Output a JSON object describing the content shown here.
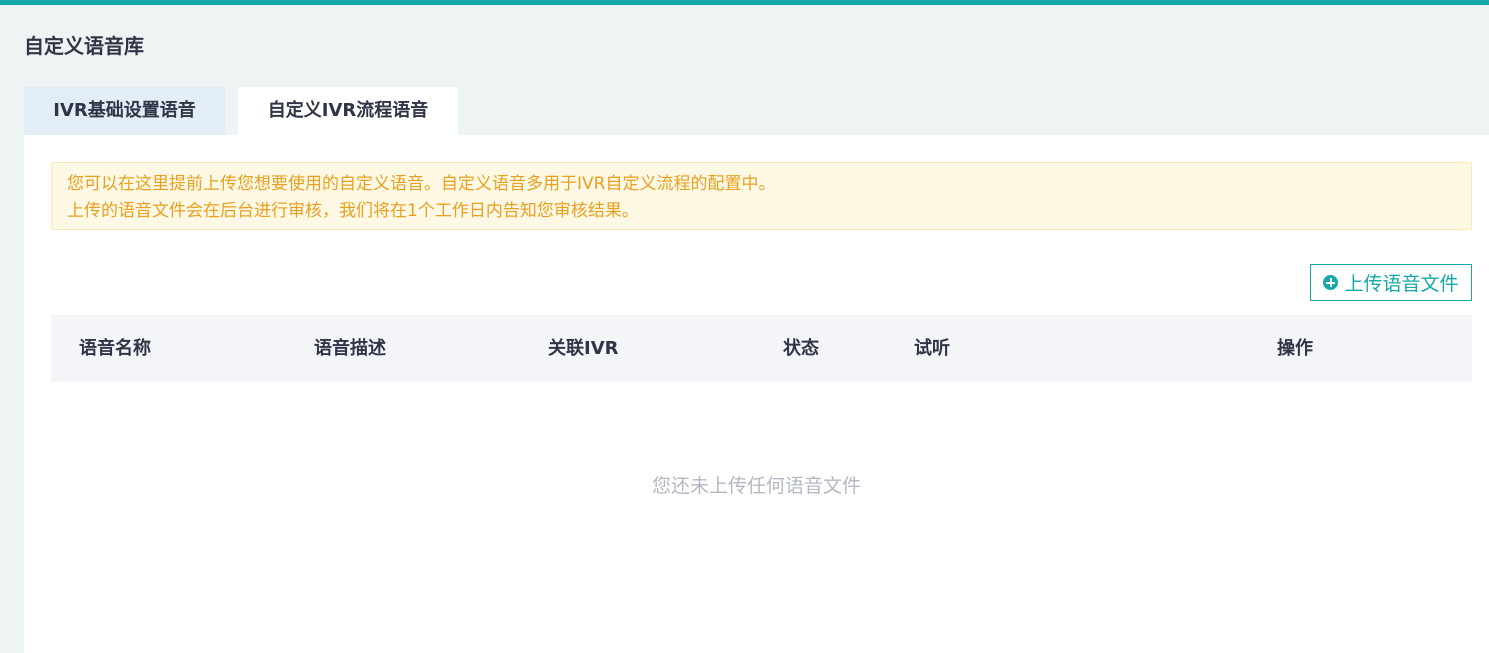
{
  "page": {
    "title": "自定义语音库"
  },
  "tabs": [
    {
      "label": "IVR基础设置语音",
      "active": false
    },
    {
      "label": "自定义IVR流程语音",
      "active": true
    }
  ],
  "notice": {
    "line1": "您可以在这里提前上传您想要使用的自定义语音。自定义语音多用于IVR自定义流程的配置中。",
    "line2": "上传的语音文件会在后台进行审核，我们将在1个工作日内告知您审核结果。"
  },
  "toolbar": {
    "upload_label": "上传语音文件",
    "upload_icon": "plus-circle-icon"
  },
  "table": {
    "columns": [
      "语音名称",
      "语音描述",
      "关联IVR",
      "状态",
      "试听",
      "操作"
    ],
    "rows": [],
    "empty_text": "您还未上传任何语音文件"
  },
  "colors": {
    "accent": "#14a8a8",
    "notice_text": "#e8a020",
    "notice_bg": "#fff8e5"
  }
}
